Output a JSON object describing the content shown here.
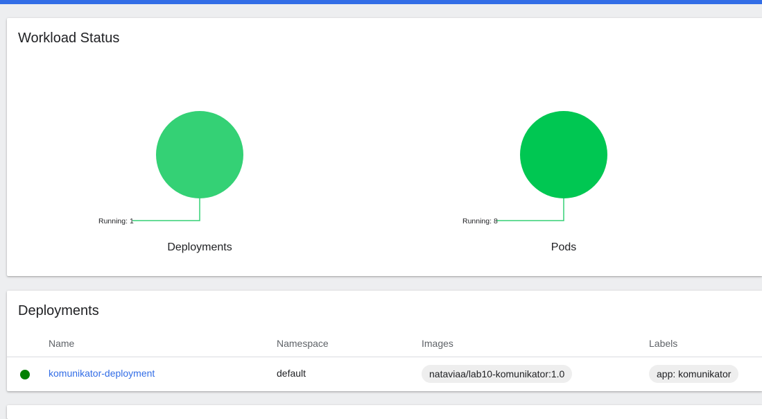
{
  "workload_status": {
    "title": "Workload Status",
    "charts": [
      {
        "caption": "Deployments",
        "label": "Running: 1",
        "running": 1,
        "color": "#34d175"
      },
      {
        "caption": "Pods",
        "label": "Running: 8",
        "running": 8,
        "color": "#00c752"
      }
    ]
  },
  "deployments": {
    "title": "Deployments",
    "columns": [
      "Name",
      "Namespace",
      "Images",
      "Labels"
    ],
    "rows": [
      {
        "status": "running",
        "status_color": "#008000",
        "name": "komunikator-deployment",
        "namespace": "default",
        "image": "nataviaa/lab10-komunikator:1.0",
        "label": "app: komunikator"
      }
    ]
  },
  "colors": {
    "accent": "#326de6",
    "leader_line": "#34d175"
  }
}
